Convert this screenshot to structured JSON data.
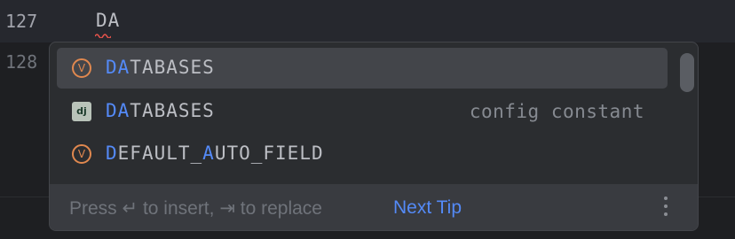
{
  "editor": {
    "lines": [
      {
        "number": "127",
        "code": "DA"
      },
      {
        "number": "128",
        "code": ""
      }
    ]
  },
  "completion": {
    "items": [
      {
        "icon": "variable-icon",
        "icon_text": "V",
        "match": "DA",
        "rest": "TABASES",
        "type": "",
        "selected": true
      },
      {
        "icon": "django-icon",
        "icon_text": "dj",
        "match": "DA",
        "rest": "TABASES",
        "type": "config constant",
        "selected": false
      },
      {
        "icon": "variable-icon",
        "icon_text": "V",
        "label_parts": [
          "D",
          "EFAULT_",
          "A",
          "UTO_FIELD"
        ],
        "type": "",
        "selected": false
      }
    ],
    "footer": {
      "hint": "Press ↵ to insert, ⇥ to replace",
      "tip_link": "Next Tip"
    }
  },
  "colors": {
    "background": "#1e1f22",
    "popup": "#2b2d30",
    "selected": "#43454a",
    "match_highlight": "#548af7",
    "variable_icon": "#e0884f"
  }
}
